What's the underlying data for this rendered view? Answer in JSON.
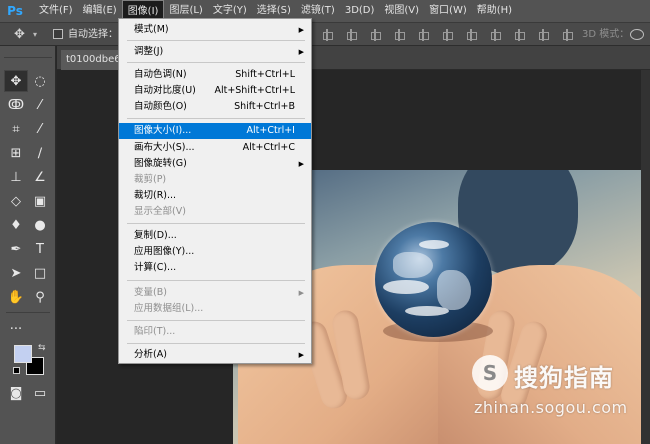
{
  "app": {
    "logo": "Ps"
  },
  "menubar": {
    "items": [
      "文件(F)",
      "编辑(E)",
      "图像(I)",
      "图层(L)",
      "文字(Y)",
      "选择(S)",
      "滤镜(T)",
      "3D(D)",
      "视图(V)",
      "窗口(W)",
      "帮助(H)"
    ],
    "active_index": 2
  },
  "options": {
    "autoselect_label": "自动选择：",
    "mode3d_label": "3D 模式："
  },
  "document": {
    "tab_title": "t0100dbe62"
  },
  "image_menu": {
    "items": [
      {
        "label": "模式(M)",
        "submenu": true
      },
      {
        "label": "调整(J)",
        "submenu": true
      },
      {
        "label": "自动色调(N)",
        "shortcut": "Shift+Ctrl+L"
      },
      {
        "label": "自动对比度(U)",
        "shortcut": "Alt+Shift+Ctrl+L"
      },
      {
        "label": "自动颜色(O)",
        "shortcut": "Shift+Ctrl+B"
      },
      {
        "label": "图像大小(I)...",
        "shortcut": "Alt+Ctrl+I",
        "highlighted": true
      },
      {
        "label": "画布大小(S)...",
        "shortcut": "Alt+Ctrl+C"
      },
      {
        "label": "图像旋转(G)",
        "submenu": true
      },
      {
        "label": "裁剪(P)",
        "disabled": true
      },
      {
        "label": "裁切(R)..."
      },
      {
        "label": "显示全部(V)",
        "disabled": true
      },
      {
        "label": "复制(D)..."
      },
      {
        "label": "应用图像(Y)..."
      },
      {
        "label": "计算(C)..."
      },
      {
        "label": "变量(B)",
        "submenu": true,
        "disabled": true
      },
      {
        "label": "应用数据组(L)...",
        "disabled": true
      },
      {
        "label": "陷印(T)...",
        "disabled": true
      },
      {
        "label": "分析(A)",
        "submenu": true
      }
    ]
  },
  "watermark": {
    "logo_glyph": "S",
    "title": "搜狗指南",
    "url": "zhinan.sogou.com"
  },
  "colors": {
    "foreground": "#c3d0f1",
    "background": "#000000",
    "menu_highlight": "#0078d7"
  }
}
